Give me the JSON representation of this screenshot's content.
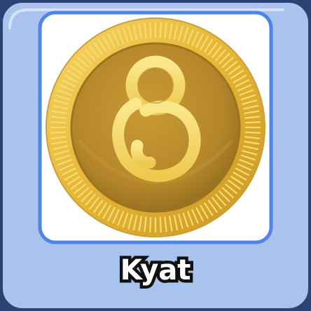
{
  "card": {
    "label": "Kyat",
    "icon": "kyat-coin-icon",
    "colors": {
      "frame": "#a9c3ee",
      "frame_border": "#2c4272",
      "panel_border": "#4d86e8",
      "panel": "#ffffff",
      "coin_rim": "#e8b938",
      "coin_face": "#b98a27",
      "glyph": "#f5dc6c"
    }
  }
}
